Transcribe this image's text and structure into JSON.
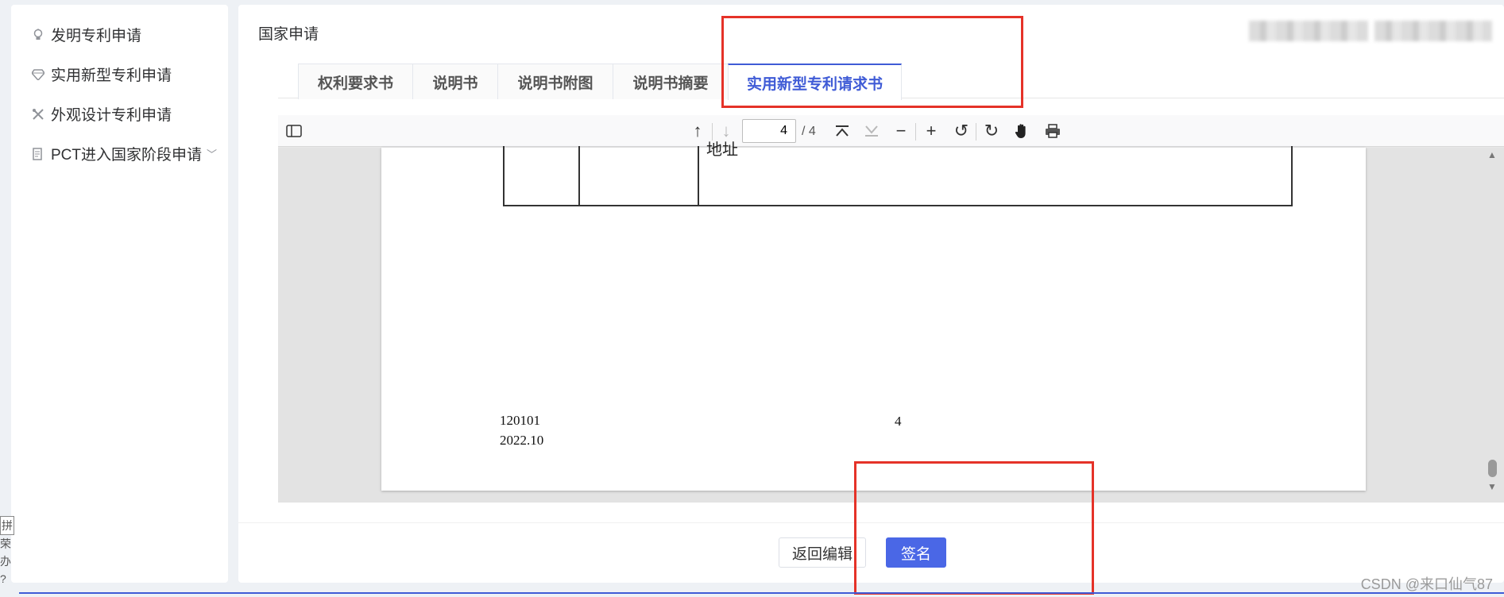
{
  "sidebar": {
    "items": [
      {
        "label": "发明专利申请",
        "icon": "lightbulb-icon"
      },
      {
        "label": "实用新型专利申请",
        "icon": "diamond-icon"
      },
      {
        "label": "外观设计专利申请",
        "icon": "tools-icon"
      },
      {
        "label": "PCT进入国家阶段申请",
        "icon": "document-icon",
        "expandable": true
      }
    ]
  },
  "edge_ime": [
    "拼",
    "荣",
    "办",
    "?"
  ],
  "main": {
    "title": "国家申请",
    "tabs": [
      {
        "label": "权利要求书",
        "active": false
      },
      {
        "label": "说明书",
        "active": false
      },
      {
        "label": "说明书附图",
        "active": false
      },
      {
        "label": "说明书摘要",
        "active": false
      },
      {
        "label": "实用新型专利请求书",
        "active": true
      }
    ],
    "accent_color": "#3f5bd6"
  },
  "viewer": {
    "current_page": "4",
    "total_pages": "/ 4",
    "cut_text": "地址",
    "footer_left_line1": "120101",
    "footer_left_line2": "2022.10",
    "page_number": "4"
  },
  "actions": {
    "back_label": "返回编辑",
    "sign_label": "签名"
  },
  "annotation_color": "#e53228",
  "watermark": "CSDN @来口仙气87"
}
